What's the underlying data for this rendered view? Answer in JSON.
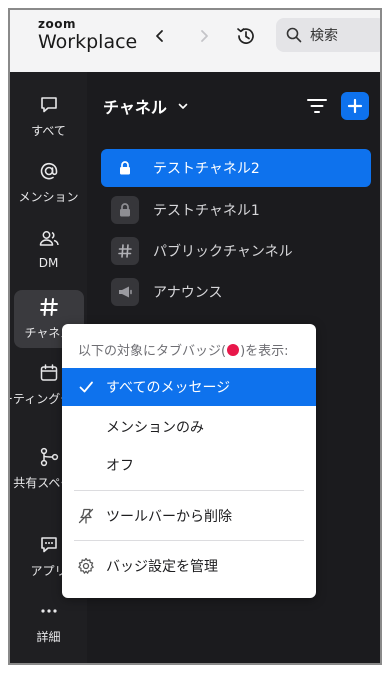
{
  "brand": {
    "zoom": "zoom",
    "product": "Workplace"
  },
  "search": {
    "placeholder": "検索"
  },
  "rail": {
    "items": [
      {
        "label": "すべて",
        "icon": "chat-bubble-icon"
      },
      {
        "label": "メンション",
        "icon": "at-icon"
      },
      {
        "label": "DM",
        "icon": "people-icon"
      },
      {
        "label": "チャネル",
        "icon": "hash-icon"
      },
      {
        "label": "ミーティングチャット",
        "icon": "calendar-icon"
      },
      {
        "label": "共有スペース",
        "icon": "share-icon"
      },
      {
        "label": "アプリ",
        "icon": "app-icon"
      },
      {
        "label": "詳細",
        "icon": "more-icon"
      }
    ]
  },
  "main": {
    "title": "チャネル",
    "channels": [
      {
        "name": "テストチャネル2",
        "icon": "lock-icon",
        "active": true
      },
      {
        "name": "テストチャネル1",
        "icon": "lock-icon",
        "active": false
      },
      {
        "name": "パブリックチャンネル",
        "icon": "hash-icon",
        "active": false
      },
      {
        "name": "アナウンス",
        "icon": "megaphone-icon",
        "active": false
      }
    ]
  },
  "menu": {
    "header_before": "以下の対象にタブバッジ(",
    "header_after": ")を表示:",
    "options": [
      {
        "label": "すべてのメッセージ",
        "selected": true
      },
      {
        "label": "メンションのみ",
        "selected": false
      },
      {
        "label": "オフ",
        "selected": false
      }
    ],
    "remove_from_toolbar": "ツールバーから削除",
    "manage_badge_settings": "バッジ設定を管理"
  },
  "colors": {
    "accent": "#0e72ed",
    "badge": "#e8174a",
    "rail_bg": "#1f1f22",
    "main_bg": "#1b1b1e"
  }
}
